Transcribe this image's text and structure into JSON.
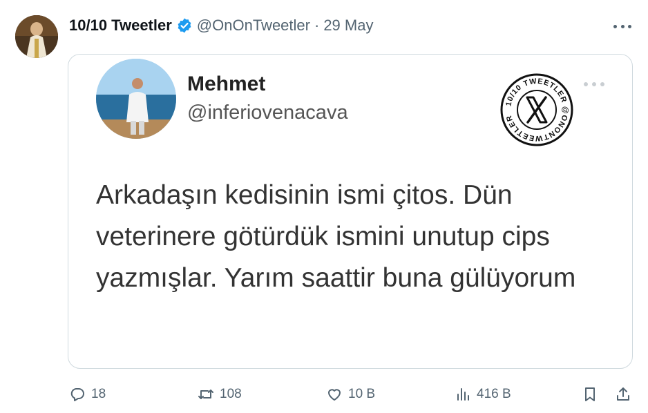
{
  "tweet": {
    "display_name": "10/10 Tweetler",
    "handle": "@OnOnTweetler",
    "separator": "·",
    "date": "29 May",
    "verified": true,
    "avatar_icon": "user-avatar"
  },
  "embedded": {
    "name": "Mehmet",
    "handle": "@inferiovenacava",
    "text": "Arkadaşın kedisinin ismi çitos. Dün veterinere götürdük ismini unutup cips yazmışlar. Yarım saattir buna gülüyorum",
    "stamp_text": "10/10 TWEETLER @ONONTWEETLER",
    "stamp_icon": "x-logo"
  },
  "actions": {
    "replies": "18",
    "retweets": "108",
    "likes": "10 B",
    "views": "416 B"
  },
  "colors": {
    "verified_badge": "#1d9bf0",
    "secondary_text": "#536471",
    "border": "#cfd9de"
  }
}
